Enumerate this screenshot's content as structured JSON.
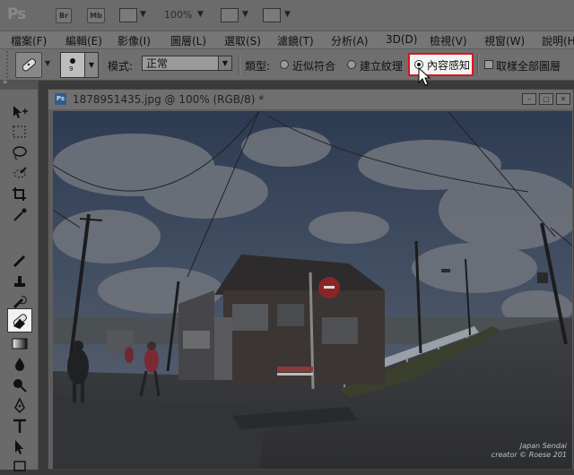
{
  "titlebar": {
    "logo": "Ps",
    "bridge": "Br",
    "minibridge": "Mb",
    "zoom": "100%"
  },
  "menubar": {
    "items": [
      "檔案(F)",
      "編輯(E)",
      "影像(I)",
      "圖層(L)",
      "選取(S)",
      "濾鏡(T)",
      "分析(A)",
      "3D(D)",
      "檢視(V)",
      "視窗(W)",
      "說明(H)"
    ]
  },
  "options": {
    "brush_size": "9",
    "mode_label": "模式:",
    "mode_value": "正常",
    "type_label": "類型:",
    "radio_proximity": "近似符合",
    "radio_texture": "建立紋理",
    "radio_content_aware": "內容感知",
    "sample_all_layers": "取樣全部圖層",
    "selected_type": "內容感知"
  },
  "document": {
    "title": "1878951435.jpg @ 100% (RGB/8) *",
    "icon": "Ps"
  },
  "photo": {
    "watermark_line1": "Japan Sendai",
    "watermark_line2": "creator © Roese 201"
  },
  "colors": {
    "highlight_border": "#e0141a",
    "ui_gray": "#6f6f6f"
  }
}
